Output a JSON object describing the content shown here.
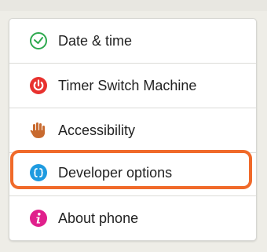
{
  "settings": {
    "items": [
      {
        "label": "Date & time",
        "icon": "clock-icon",
        "color": "#2ea94f"
      },
      {
        "label": "Timer Switch Machine",
        "icon": "power-icon",
        "color": "#e8312e"
      },
      {
        "label": "Accessibility",
        "icon": "hand-icon",
        "color": "#c86a2f"
      },
      {
        "label": "Developer options",
        "icon": "braces-icon",
        "color": "#1e9be0"
      },
      {
        "label": "About phone",
        "icon": "info-icon",
        "color": "#e0208c"
      }
    ],
    "highlight_color": "#f06a2a"
  }
}
